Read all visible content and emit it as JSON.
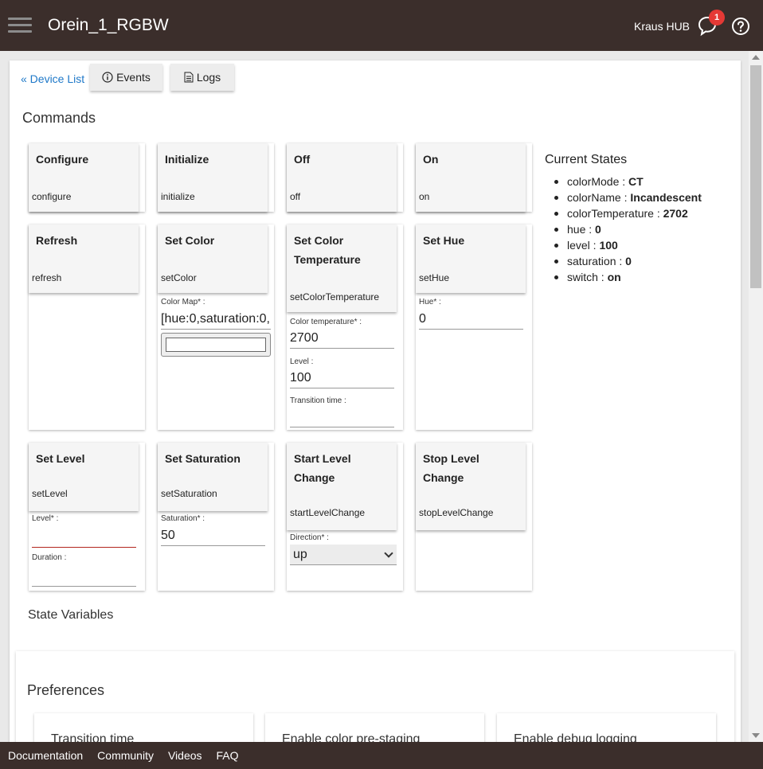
{
  "header": {
    "title": "Orein_1_RGBW",
    "hub_name": "Kraus HUB",
    "notification_count": "1"
  },
  "nav": {
    "device_list": "« Device List",
    "events": "Events",
    "logs": "Logs"
  },
  "commands": {
    "heading": "Commands",
    "items": [
      {
        "title": "Configure",
        "name": "configure"
      },
      {
        "title": "Initialize",
        "name": "initialize"
      },
      {
        "title": "Off",
        "name": "off"
      },
      {
        "title": "On",
        "name": "on"
      },
      {
        "title": "Refresh",
        "name": "refresh"
      },
      {
        "title": "Set Color",
        "name": "setColor",
        "fields": [
          {
            "label": "Color Map* :",
            "value": "[hue:0,saturation:0,l"
          }
        ]
      },
      {
        "title": "Set Color Temperature",
        "name": "setColorTemperature",
        "fields": [
          {
            "label": "Color temperature* :",
            "value": "2700"
          },
          {
            "label": "Level :",
            "value": "100"
          },
          {
            "label": "Transition time :",
            "value": ""
          }
        ]
      },
      {
        "title": "Set Hue",
        "name": "setHue",
        "fields": [
          {
            "label": "Hue* :",
            "value": "0"
          }
        ]
      },
      {
        "title": "Set Level",
        "name": "setLevel",
        "fields": [
          {
            "label": "Level* :",
            "value": ""
          },
          {
            "label": "Duration :",
            "value": ""
          }
        ]
      },
      {
        "title": "Set Saturation",
        "name": "setSaturation",
        "fields": [
          {
            "label": "Saturation* :",
            "value": "50"
          }
        ]
      },
      {
        "title": "Start Level Change",
        "name": "startLevelChange",
        "fields": [
          {
            "label": "Direction* :",
            "value": "up"
          }
        ]
      },
      {
        "title": "Stop Level Change",
        "name": "stopLevelChange"
      }
    ]
  },
  "current_states": {
    "title": "Current States",
    "items": [
      {
        "key": "colorMode",
        "value": "CT"
      },
      {
        "key": "colorName",
        "value": "Incandescent"
      },
      {
        "key": "colorTemperature",
        "value": "2702"
      },
      {
        "key": "hue",
        "value": "0"
      },
      {
        "key": "level",
        "value": "100"
      },
      {
        "key": "saturation",
        "value": "0"
      },
      {
        "key": "switch",
        "value": "on"
      }
    ]
  },
  "state_variables": {
    "heading": "State Variables"
  },
  "preferences": {
    "heading": "Preferences",
    "items": [
      "Transition time",
      "Enable color pre-staging",
      "Enable debug logging"
    ]
  },
  "footer": {
    "links": [
      "Documentation",
      "Community",
      "Videos",
      "FAQ"
    ]
  },
  "colors": {
    "header_bg": "#3b2e2b",
    "link": "#1e78c8",
    "badge": "#e53935"
  }
}
